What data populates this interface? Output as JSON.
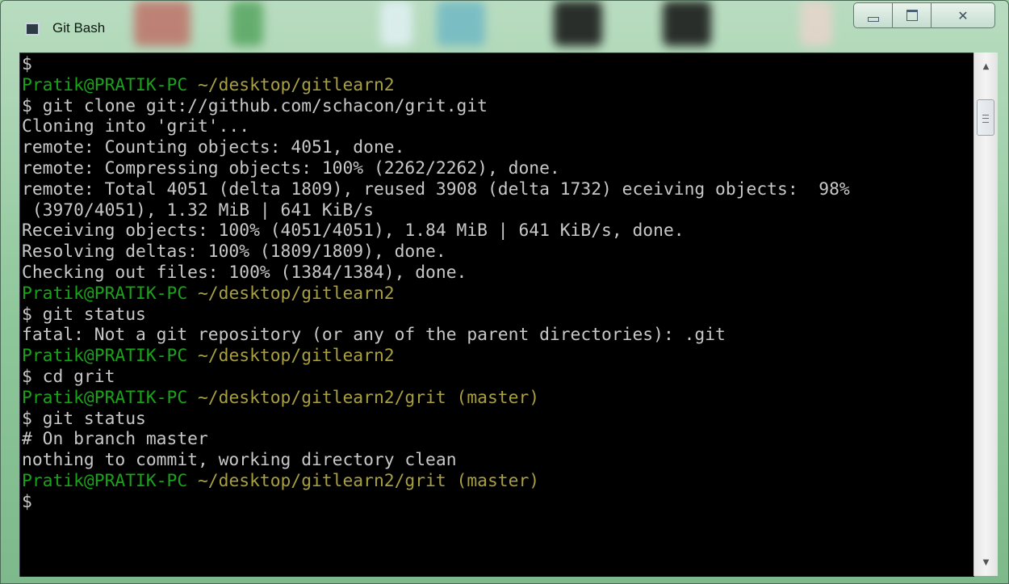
{
  "window": {
    "title": "Git Bash",
    "icons": {
      "app": "terminal-icon",
      "minimize": "minimize-icon",
      "maximize": "maximize-icon",
      "close": "close-icon"
    },
    "close_glyph": "✕",
    "colors": {
      "prompt_user": "#1aa21a",
      "prompt_path": "#a8a040",
      "output": "#c8c8c8",
      "background": "#000000"
    }
  },
  "terminal": {
    "lines": [
      [
        {
          "text": "$",
          "color": "gray"
        }
      ],
      [
        {
          "text": "Pratik@PRATIK-PC",
          "color": "green"
        },
        {
          "text": " ~/desktop/gitlearn2",
          "color": "olive"
        }
      ],
      [
        {
          "text": "$ git clone git://github.com/schacon/grit.git",
          "color": "gray"
        }
      ],
      [
        {
          "text": "Cloning into 'grit'...",
          "color": "gray"
        }
      ],
      [
        {
          "text": "remote: Counting objects: 4051, done.",
          "color": "gray"
        }
      ],
      [
        {
          "text": "remote: Compressing objects: 100% (2262/2262), done.",
          "color": "gray"
        }
      ],
      [
        {
          "text": "remote: Total 4051 (delta 1809), reused 3908 (delta 1732) eceiving objects:  98%",
          "color": "gray"
        }
      ],
      [
        {
          "text": " (3970/4051), 1.32 MiB | 641 KiB/s",
          "color": "gray"
        }
      ],
      [
        {
          "text": "Receiving objects: 100% (4051/4051), 1.84 MiB | 641 KiB/s, done.",
          "color": "gray"
        }
      ],
      [
        {
          "text": "Resolving deltas: 100% (1809/1809), done.",
          "color": "gray"
        }
      ],
      [
        {
          "text": "Checking out files: 100% (1384/1384), done.",
          "color": "gray"
        }
      ],
      [
        {
          "text": "Pratik@PRATIK-PC",
          "color": "green"
        },
        {
          "text": " ~/desktop/gitlearn2",
          "color": "olive"
        }
      ],
      [
        {
          "text": "$ git status",
          "color": "gray"
        }
      ],
      [
        {
          "text": "fatal: Not a git repository (or any of the parent directories): .git",
          "color": "gray"
        }
      ],
      [
        {
          "text": "Pratik@PRATIK-PC",
          "color": "green"
        },
        {
          "text": " ~/desktop/gitlearn2",
          "color": "olive"
        }
      ],
      [
        {
          "text": "$ cd grit",
          "color": "gray"
        }
      ],
      [
        {
          "text": "Pratik@PRATIK-PC",
          "color": "green"
        },
        {
          "text": " ~/desktop/gitlearn2/grit (master)",
          "color": "olive"
        }
      ],
      [
        {
          "text": "$ git status",
          "color": "gray"
        }
      ],
      [
        {
          "text": "# On branch master",
          "color": "gray"
        }
      ],
      [
        {
          "text": "nothing to commit, working directory clean",
          "color": "gray"
        }
      ],
      [
        {
          "text": "Pratik@PRATIK-PC",
          "color": "green"
        },
        {
          "text": " ~/desktop/gitlearn2/grit (master)",
          "color": "olive"
        }
      ],
      [
        {
          "text": "$",
          "color": "gray"
        }
      ]
    ]
  },
  "scrollbar": {
    "up_icon": "scroll-up-arrow-icon",
    "down_icon": "scroll-down-arrow-icon",
    "up_glyph": "▲",
    "down_glyph": "▼"
  }
}
